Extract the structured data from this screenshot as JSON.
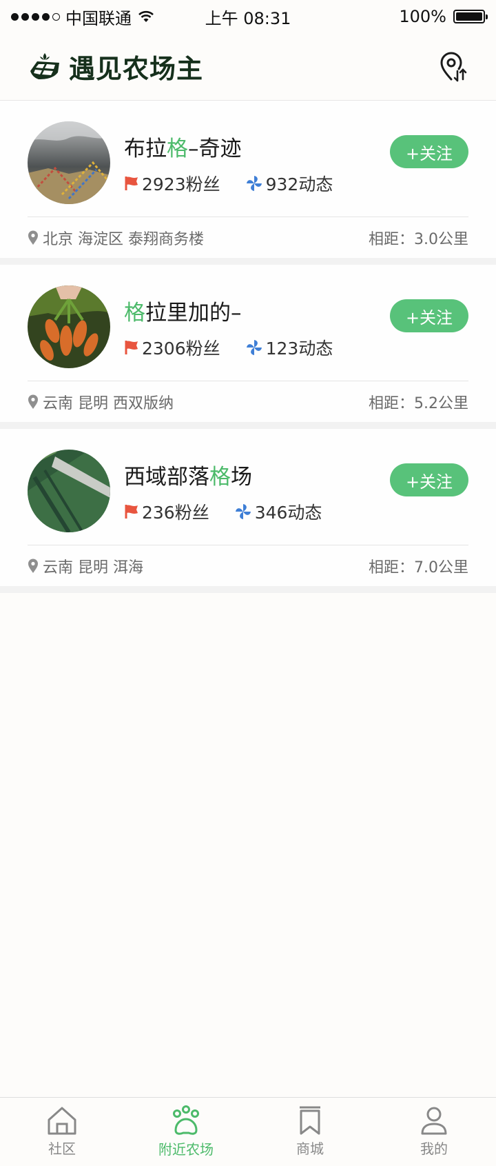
{
  "status_bar": {
    "carrier": "中国联通",
    "time": "上午 08:31",
    "battery": "100%"
  },
  "header": {
    "title": "遇见农场主",
    "brand_icon": "farm-logo-icon",
    "action_icon": "location-pin-icon"
  },
  "farms": [
    {
      "name_parts": [
        "布拉",
        "格",
        "–奇迹"
      ],
      "fans": "2923粉丝",
      "posts": "932动态",
      "follow_label": "+关注",
      "address": "北京 海淀区 泰翔商务楼",
      "distance": "相距：3.0公里",
      "avatar_icon": "mountain-flags-photo"
    },
    {
      "name_parts": [
        "",
        "格",
        "拉里加的–"
      ],
      "fans": "2306粉丝",
      "posts": "123动态",
      "follow_label": "+关注",
      "address": "云南 昆明 西双版纳",
      "distance": "相距：5.2公里",
      "avatar_icon": "carrots-photo"
    },
    {
      "name_parts": [
        "西域部落",
        "格",
        "场"
      ],
      "fans": "236粉丝",
      "posts": "346动态",
      "follow_label": "+关注",
      "address": "云南 昆明 洱海",
      "distance": "相距：7.0公里",
      "avatar_icon": "field-aerial-photo"
    }
  ],
  "tabs": [
    {
      "label": "社区",
      "icon": "home-icon",
      "active": false
    },
    {
      "label": "附近农场",
      "icon": "paw-icon",
      "active": true
    },
    {
      "label": "商城",
      "icon": "bookmark-icon",
      "active": false
    },
    {
      "label": "我的",
      "icon": "user-icon",
      "active": false
    }
  ],
  "colors": {
    "accent": "#4cba6a",
    "button": "#58c27a",
    "flag": "#e8553f",
    "pinwheel": "#3f7fd6"
  }
}
